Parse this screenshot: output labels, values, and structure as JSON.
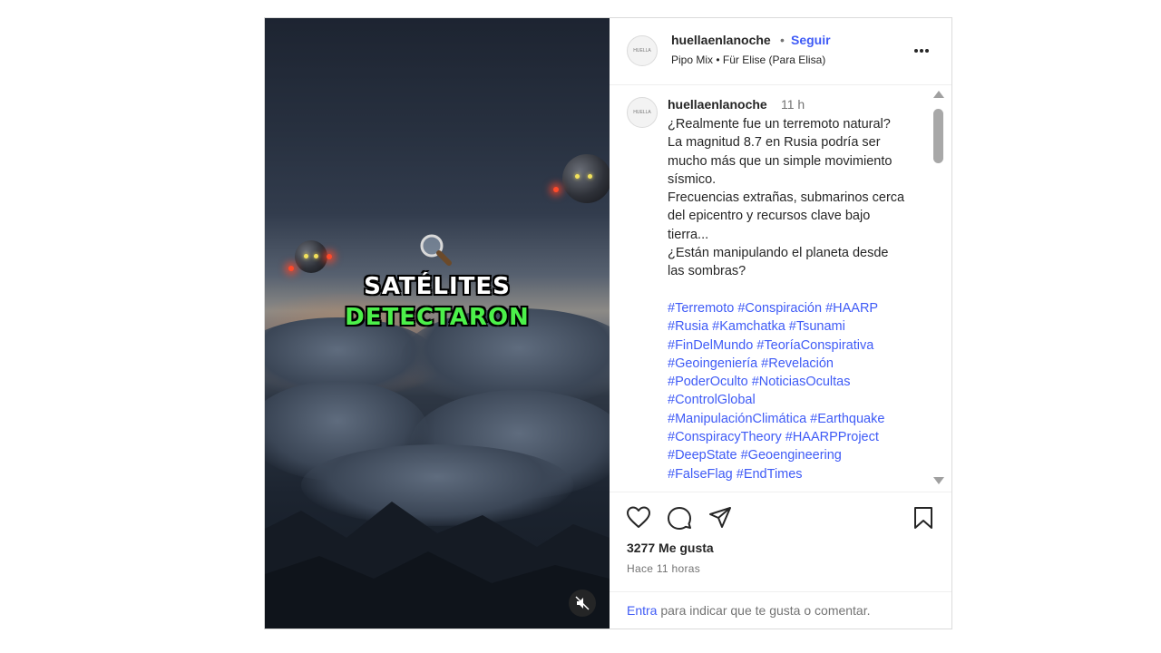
{
  "post": {
    "media": {
      "overlay_line1": "SATÉLITES",
      "overlay_line2": "DETECTARON",
      "magnifier_icon": "magnifying-glass-icon",
      "mute_icon": "speaker-muted-icon"
    },
    "header": {
      "username": "huellaenlanoche",
      "separator": "•",
      "follow_label": "Seguir",
      "audio": "Pipo Mix • Für Elise (Para Elisa)",
      "avatar_text": "HUELLA",
      "more_icon": "more-options-icon"
    },
    "caption": {
      "username": "huellaenlanoche",
      "time": "11 h",
      "avatar_text": "HUELLA",
      "text_lines": [
        "¿Realmente fue un terremoto natural?",
        "La magnitud 8.7 en Rusia podría ser",
        "mucho más que un simple movimiento",
        "sísmico.",
        "Frecuencias extrañas, submarinos cerca",
        "del epicentro y recursos clave bajo",
        "tierra...",
        "¿Están manipulando el planeta desde",
        "las sombras?"
      ],
      "hashtag_lines": [
        "#Terremoto #Conspiración #HAARP",
        "#Rusia #Kamchatka #Tsunami",
        "#FinDelMundo #TeoríaConspirativa",
        "#Geoingeniería #Revelación",
        "#PoderOculto #NoticiasOcultas",
        "#ControlGlobal",
        "#ManipulaciónClimática #Earthquake",
        "#ConspiracyTheory #HAARPProject",
        "#DeepState #Geoengineering",
        "#FalseFlag #EndTimes"
      ]
    },
    "actions": {
      "like_icon": "heart-icon",
      "comment_icon": "comment-icon",
      "share_icon": "send-icon",
      "save_icon": "bookmark-icon",
      "likes_text": "3277 Me gusta",
      "time_text": "Hace 11 horas",
      "login_link": "Entra",
      "login_rest": " para indicar que te gusta o comentar."
    },
    "colors": {
      "link": "#3f5bf6",
      "overlay_green": "#4cf04a"
    }
  }
}
